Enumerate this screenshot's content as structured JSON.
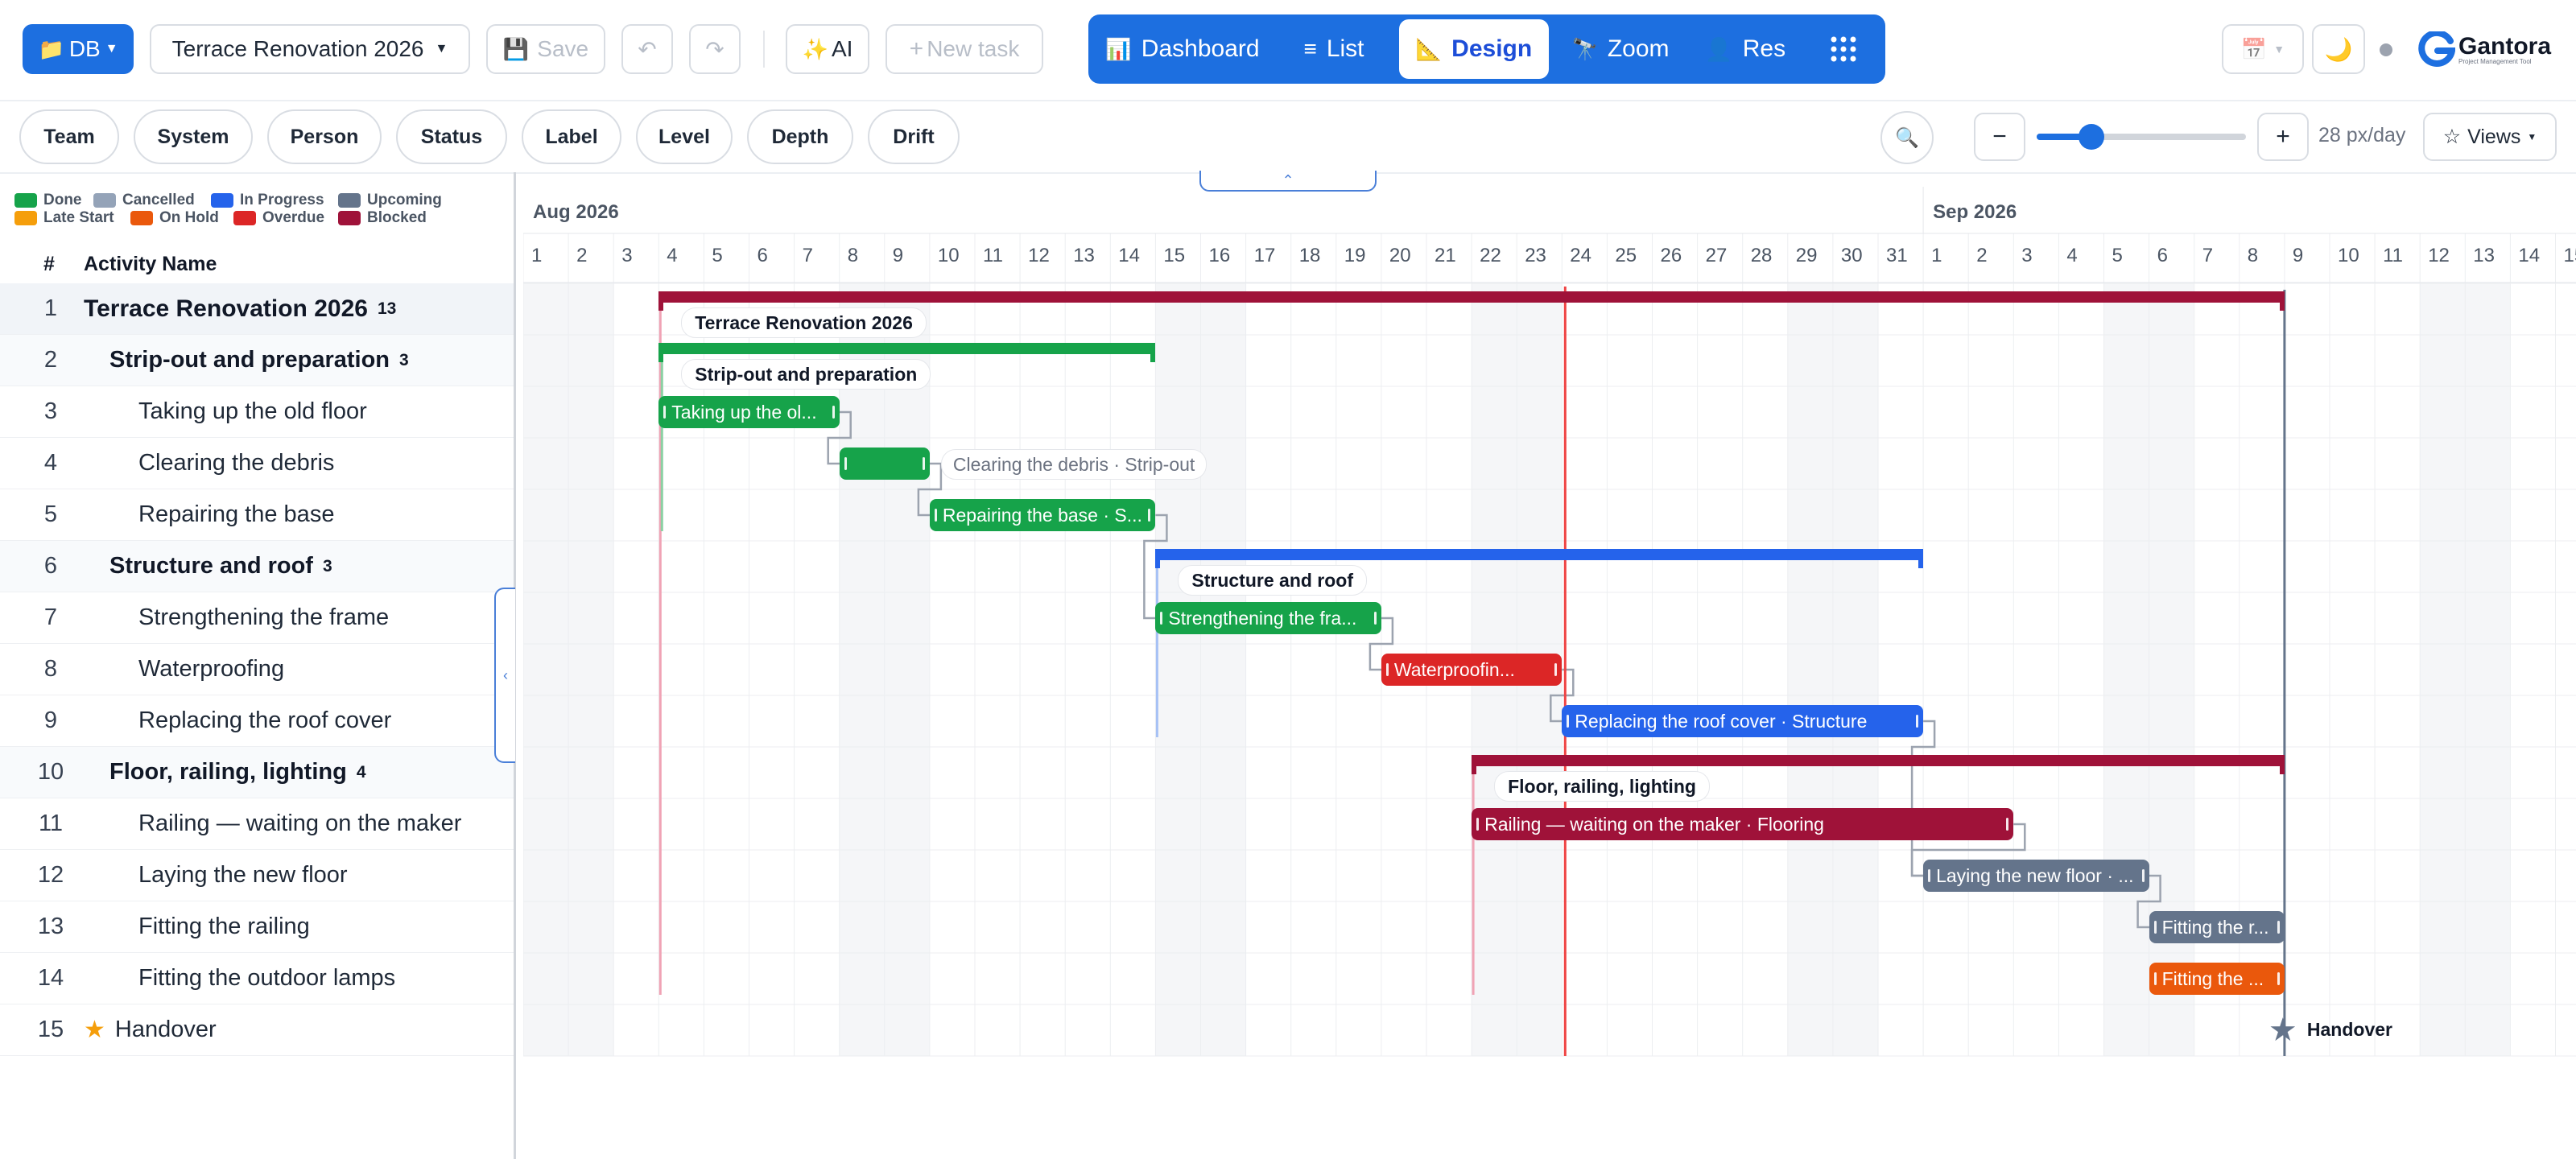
{
  "toolbar": {
    "db_label": "DB",
    "project_name": "Terrace Renovation 2026",
    "save_label": "Save",
    "ai_label": "AI",
    "new_task_label": "New task",
    "views": [
      "Dashboard",
      "List",
      "Design",
      "Zoom",
      "Res"
    ],
    "active_view": "Design",
    "brand": "Gantora",
    "brand_tagline": "Project Management Tool"
  },
  "filters": [
    "Team",
    "System",
    "Person",
    "Status",
    "Label",
    "Level",
    "Depth",
    "Drift"
  ],
  "zoom": {
    "label": "28 px/day",
    "minus": "−",
    "plus": "+",
    "slider_fraction": 0.26,
    "views_label": "Views"
  },
  "legend": [
    {
      "label": "Done",
      "color": "#16a34a"
    },
    {
      "label": "Cancelled",
      "color": "#94a3b8"
    },
    {
      "label": "In Progress",
      "color": "#2563eb"
    },
    {
      "label": "Upcoming",
      "color": "#64748b"
    },
    {
      "label": "Late Start",
      "color": "#f59e0b"
    },
    {
      "label": "On Hold",
      "color": "#ea580c"
    },
    {
      "label": "Overdue",
      "color": "#dc2626"
    },
    {
      "label": "Blocked",
      "color": "#9f1239"
    }
  ],
  "table": {
    "col_num": "#",
    "col_name": "Activity Name",
    "rows": [
      {
        "n": "1",
        "name": "Terrace Renovation 2026",
        "count": "13",
        "level": 0,
        "group": true
      },
      {
        "n": "2",
        "name": "Strip-out and preparation",
        "count": "3",
        "level": 1,
        "group": true
      },
      {
        "n": "3",
        "name": "Taking up the old floor",
        "count": "",
        "level": 2,
        "group": false
      },
      {
        "n": "4",
        "name": "Clearing the debris",
        "count": "",
        "level": 2,
        "group": false
      },
      {
        "n": "5",
        "name": "Repairing the base",
        "count": "",
        "level": 2,
        "group": false
      },
      {
        "n": "6",
        "name": "Structure and roof",
        "count": "3",
        "level": 1,
        "group": true
      },
      {
        "n": "7",
        "name": "Strengthening the frame",
        "count": "",
        "level": 2,
        "group": false
      },
      {
        "n": "8",
        "name": "Waterproofing",
        "count": "",
        "level": 2,
        "group": false
      },
      {
        "n": "9",
        "name": "Replacing the roof cover",
        "count": "",
        "level": 2,
        "group": false
      },
      {
        "n": "10",
        "name": "Floor, railing, lighting",
        "count": "4",
        "level": 1,
        "group": true
      },
      {
        "n": "11",
        "name": "Railing — waiting on the maker",
        "count": "",
        "level": 2,
        "group": false
      },
      {
        "n": "12",
        "name": "Laying the new floor",
        "count": "",
        "level": 2,
        "group": false
      },
      {
        "n": "13",
        "name": "Fitting the railing",
        "count": "",
        "level": 2,
        "group": false
      },
      {
        "n": "14",
        "name": "Fitting the outdoor lamps",
        "count": "",
        "level": 2,
        "group": false
      },
      {
        "n": "15",
        "name": "Handover",
        "count": "",
        "level": 0,
        "group": false,
        "milestone": true
      }
    ]
  },
  "timeline": {
    "months": [
      {
        "label": "Aug 2026",
        "start": "2026-08-01"
      },
      {
        "label": "Sep 2026",
        "start": "2026-09-01"
      }
    ],
    "days": [
      "1",
      "2",
      "3",
      "4",
      "5",
      "6",
      "7",
      "8",
      "9",
      "10",
      "11",
      "12",
      "13",
      "14",
      "15",
      "16",
      "17",
      "18",
      "19",
      "20",
      "21",
      "22",
      "23",
      "24",
      "25",
      "26",
      "27",
      "28",
      "29",
      "30",
      "31",
      "1",
      "2",
      "3",
      "4",
      "5",
      "6",
      "7",
      "8",
      "9",
      "10",
      "11",
      "12",
      "13",
      "14",
      "15"
    ],
    "today": "2026-08-24"
  },
  "gantt": [
    {
      "row": 1,
      "type": "summary",
      "start": "2026-08-04",
      "end": "2026-09-09",
      "label": "Terrace Renovation 2026",
      "color": "#9f1239"
    },
    {
      "row": 2,
      "type": "summary",
      "start": "2026-08-04",
      "end": "2026-08-15",
      "label": "Strip-out and preparation",
      "color": "#16a34a"
    },
    {
      "row": 3,
      "type": "task",
      "start": "2026-08-04",
      "end": "2026-08-08",
      "label": "Taking up the ol...",
      "color": "#16a34a"
    },
    {
      "row": 4,
      "type": "task",
      "start": "2026-08-08",
      "end": "2026-08-10",
      "label": "",
      "outside_label": "Clearing the debris · Strip-out",
      "color": "#16a34a"
    },
    {
      "row": 5,
      "type": "task",
      "start": "2026-08-10",
      "end": "2026-08-15",
      "label": "Repairing the base · S...",
      "color": "#16a34a"
    },
    {
      "row": 6,
      "type": "summary",
      "start": "2026-08-15",
      "end": "2026-09-01",
      "label": "Structure and roof",
      "color": "#2563eb"
    },
    {
      "row": 7,
      "type": "task",
      "start": "2026-08-15",
      "end": "2026-08-20",
      "label": "Strengthening the fra...",
      "color": "#16a34a"
    },
    {
      "row": 8,
      "type": "task",
      "start": "2026-08-20",
      "end": "2026-08-24",
      "label": "Waterproofin...",
      "color": "#dc2626"
    },
    {
      "row": 9,
      "type": "task",
      "start": "2026-08-24",
      "end": "2026-09-01",
      "label": "Replacing the roof cover · Structure",
      "color": "#2563eb"
    },
    {
      "row": 10,
      "type": "summary",
      "start": "2026-08-22",
      "end": "2026-09-09",
      "label": "Floor, railing, lighting",
      "color": "#9f1239"
    },
    {
      "row": 11,
      "type": "task",
      "start": "2026-08-22",
      "end": "2026-09-03",
      "label": "Railing — waiting on the maker · Flooring",
      "color": "#9f1239"
    },
    {
      "row": 12,
      "type": "task",
      "start": "2026-09-01",
      "end": "2026-09-06",
      "label": "Laying the new floor · ...",
      "color": "#64748b"
    },
    {
      "row": 13,
      "type": "task",
      "start": "2026-09-06",
      "end": "2026-09-09",
      "label": "Fitting the r...",
      "color": "#64748b"
    },
    {
      "row": 14,
      "type": "task",
      "start": "2026-09-06",
      "end": "2026-09-09",
      "label": "Fitting the ...",
      "color": "#ea580c"
    },
    {
      "row": 15,
      "type": "milestone",
      "start": "2026-09-09",
      "end": "2026-09-09",
      "label": "Handover",
      "color": "#64748b"
    }
  ],
  "dependencies": [
    [
      3,
      4
    ],
    [
      4,
      5
    ],
    [
      5,
      7
    ],
    [
      7,
      8
    ],
    [
      8,
      9
    ],
    [
      9,
      12
    ],
    [
      11,
      12
    ],
    [
      12,
      13
    ]
  ]
}
